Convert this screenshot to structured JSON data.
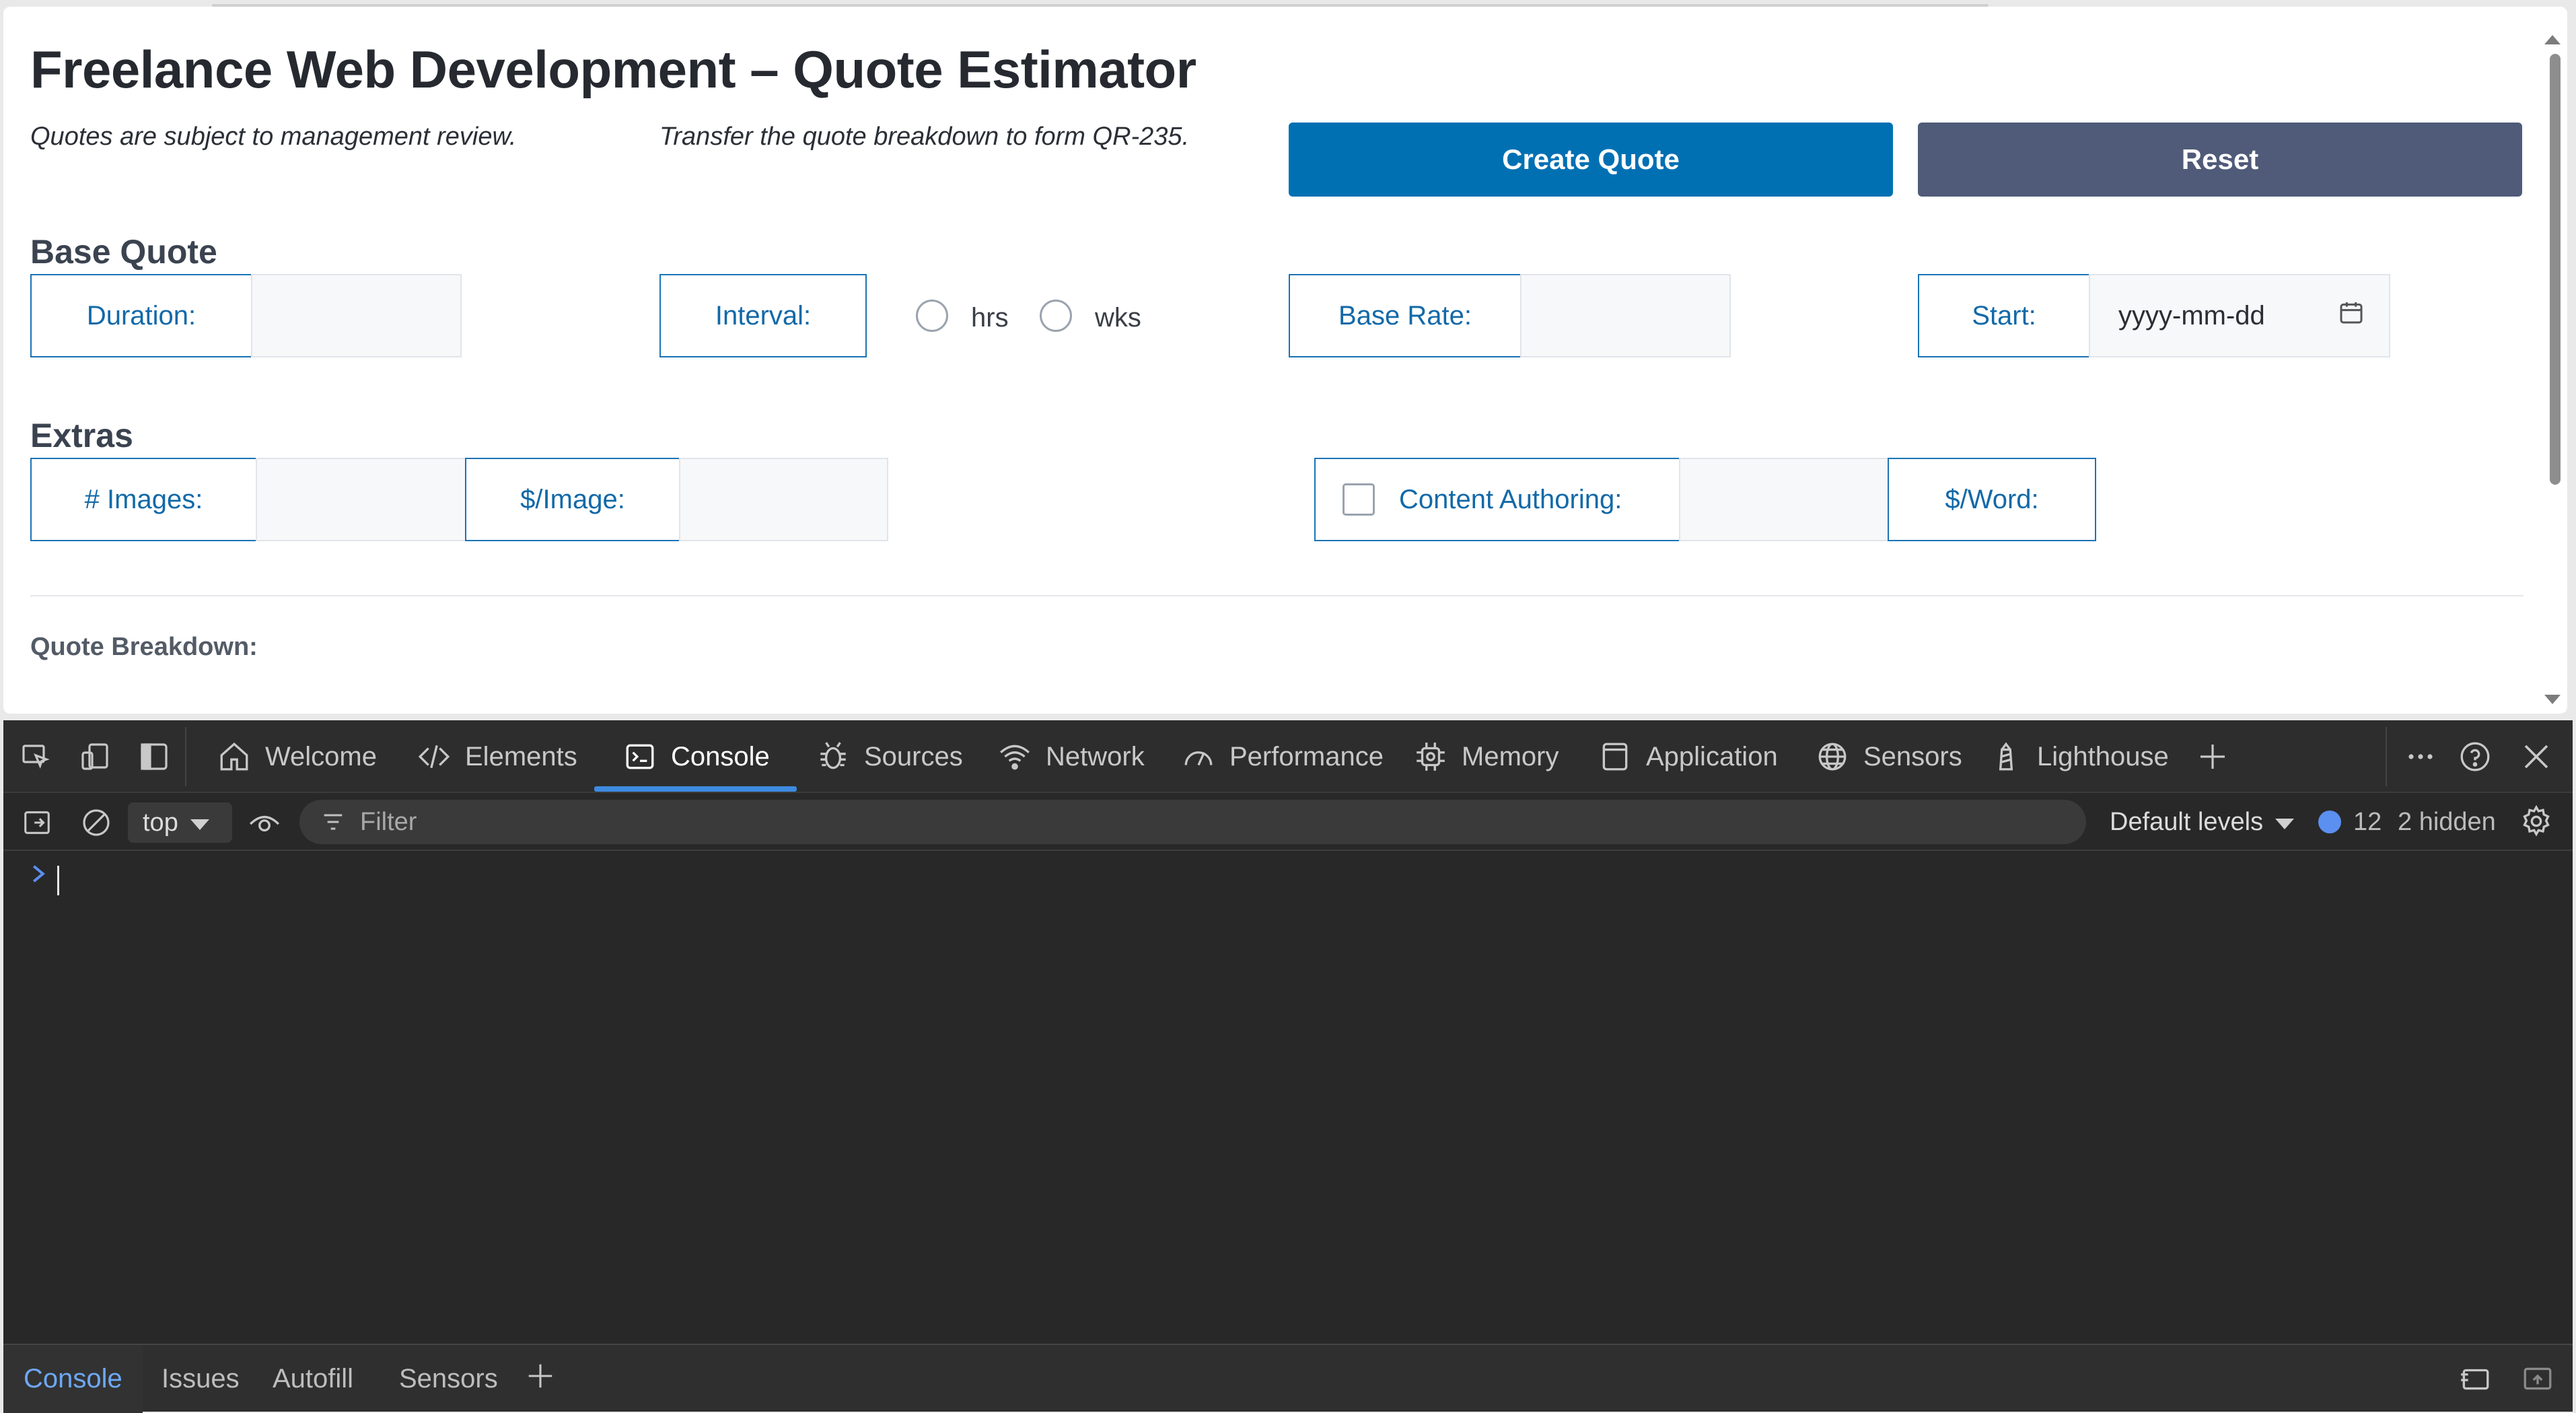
{
  "app": {
    "title": "Freelance Web Development – Quote Estimator",
    "note_review": "Quotes are subject to management review.",
    "note_transfer": "Transfer the quote breakdown to form QR-235.",
    "create_button": "Create Quote",
    "reset_button": "Reset",
    "base_section": {
      "heading": "Base Quote",
      "duration_label": "Duration:",
      "duration_value": "",
      "interval_label": "Interval:",
      "interval_options": [
        "hrs",
        "wks"
      ],
      "base_rate_label": "Base Rate:",
      "base_rate_value": "",
      "start_label": "Start:",
      "start_placeholder": "yyyy-mm-dd"
    },
    "extras_section": {
      "heading": "Extras",
      "images_label": "# Images:",
      "images_value": "",
      "per_image_label": "$/Image:",
      "per_image_value": "",
      "content_label": "Content Authoring:",
      "content_value": "",
      "per_word_label": "$/Word:"
    },
    "breakdown_label": "Quote Breakdown:"
  },
  "devtools": {
    "tabs": [
      {
        "label": "Welcome",
        "icon": "home-icon"
      },
      {
        "label": "Elements",
        "icon": "code-icon"
      },
      {
        "label": "Console",
        "icon": "console-icon",
        "active": true
      },
      {
        "label": "Sources",
        "icon": "bug-icon"
      },
      {
        "label": "Network",
        "icon": "wifi-icon"
      },
      {
        "label": "Performance",
        "icon": "gauge-icon"
      },
      {
        "label": "Memory",
        "icon": "chip-icon"
      },
      {
        "label": "Application",
        "icon": "app-window-icon"
      },
      {
        "label": "Sensors",
        "icon": "globe-icon"
      },
      {
        "label": "Lighthouse",
        "icon": "lighthouse-icon"
      }
    ],
    "toolbar": {
      "context": "top",
      "filter_placeholder": "Filter",
      "levels": "Default levels",
      "message_count": "12",
      "hidden": "2 hidden"
    },
    "drawer_tabs": [
      "Console",
      "Issues",
      "Autofill",
      "Sensors"
    ],
    "colors": {
      "accent": "#3d8ae0",
      "primary_button": "#0070b3",
      "secondary_button": "#4f5b78"
    }
  }
}
